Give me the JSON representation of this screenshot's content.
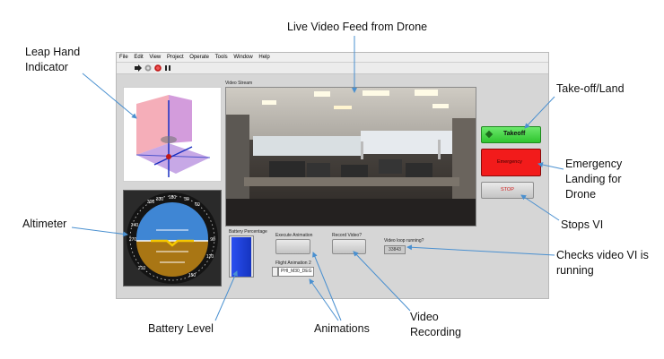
{
  "annotations": {
    "leap_hand": [
      "Leap Hand",
      "Indicator"
    ],
    "live_video": "Live Video Feed from Drone",
    "takeoff_land": "Take-off/Land",
    "emergency": [
      "Emergency",
      "Landing for",
      "Drone"
    ],
    "stops_vi": "Stops VI",
    "checks_video": [
      "Checks video VI is",
      "running"
    ],
    "altimeter": "Altimeter",
    "battery": "Battery Level",
    "animations": "Animations",
    "video_recording": [
      "Video",
      "Recording"
    ]
  },
  "menu": [
    "File",
    "Edit",
    "View",
    "Project",
    "Operate",
    "Tools",
    "Window",
    "Help"
  ],
  "toolbar_icons": [
    "run-arrow-icon",
    "run-continuously-icon",
    "abort-icon",
    "pause-icon"
  ],
  "panel": {
    "video_stream_label": "Video Stream",
    "takeoff_label": "Takeoff",
    "emergency_label": "Emergency",
    "stop_label": "STOP",
    "battery_label": "Battery Percentage",
    "execute_animation_label": "Execute Animation",
    "record_video_label": "Record Video?",
    "video_loop_label": "Video loop running?",
    "video_loop_value": "33843",
    "flight_animation_label": "Flight Animation 2",
    "flight_animation_value": "PHI_M30_DEG"
  },
  "colors": {
    "takeoff_green": "#3fd13f",
    "emergency_red": "#f21b1b",
    "battery_blue": "#1a3fd8",
    "sky_blue": "#4a8fd6",
    "ground_brown": "#b07a1a",
    "arrow_blue": "#4a90d0"
  },
  "altimeter_scale": [
    "300",
    "330",
    "30",
    "60",
    "240",
    "270",
    "90",
    "120",
    "210",
    "150",
    "180"
  ]
}
